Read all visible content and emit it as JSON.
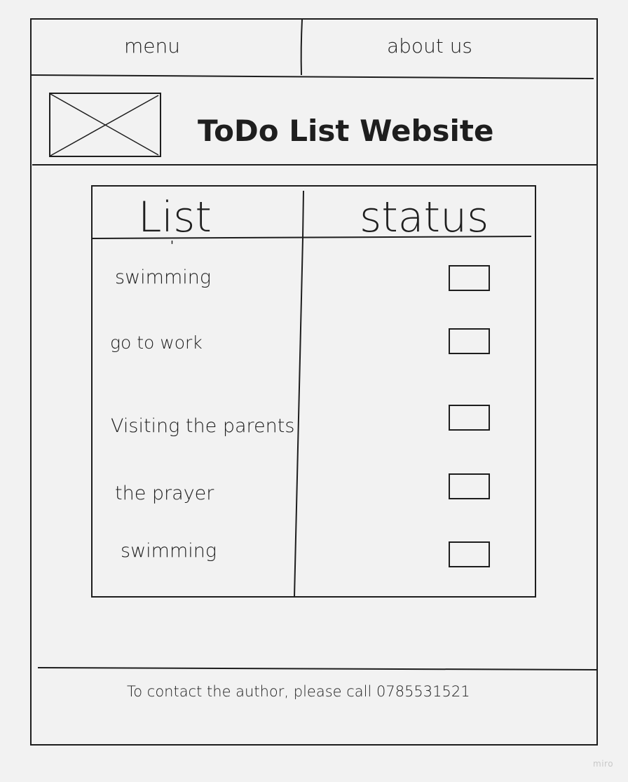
{
  "nav": {
    "menu_label": "menu",
    "about_label": "about us"
  },
  "header": {
    "title": "ToDo List Website"
  },
  "table": {
    "columns": [
      "List",
      "status"
    ],
    "tick_mark": "'",
    "rows": [
      {
        "task": "swimming"
      },
      {
        "task": "go to work"
      },
      {
        "task": "Visiting the parents"
      },
      {
        "task": "the prayer"
      },
      {
        "task": "swimming"
      }
    ]
  },
  "footer": {
    "contact_text": "To contact the author, please call 0785531521"
  },
  "watermark": {
    "brand": "miro"
  },
  "icons": {
    "logo": "image-placeholder-icon",
    "status": "checkbox-icon"
  },
  "colors": {
    "background": "#f2f2f2",
    "ink": "#1e1e1e"
  }
}
